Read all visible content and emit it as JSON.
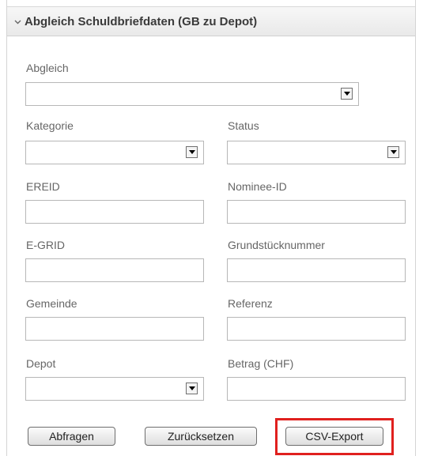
{
  "panel": {
    "title": "Abgleich Schuldbriefdaten (GB zu Depot)"
  },
  "fields": {
    "abgleich": {
      "label": "Abgleich",
      "value": ""
    },
    "kategorie": {
      "label": "Kategorie",
      "value": ""
    },
    "status": {
      "label": "Status",
      "value": ""
    },
    "ereid": {
      "label": "EREID",
      "value": ""
    },
    "nominee_id": {
      "label": "Nominee-ID",
      "value": ""
    },
    "egrid": {
      "label": "E-GRID",
      "value": ""
    },
    "grundstuecknummer": {
      "label": "Grundstücknummer",
      "value": ""
    },
    "gemeinde": {
      "label": "Gemeinde",
      "value": ""
    },
    "referenz": {
      "label": "Referenz",
      "value": ""
    },
    "depot": {
      "label": "Depot",
      "value": ""
    },
    "betrag": {
      "label": "Betrag (CHF)",
      "value": ""
    }
  },
  "buttons": {
    "query": "Abfragen",
    "reset": "Zurücksetzen",
    "csv_export": "CSV-Export"
  },
  "colors": {
    "highlight": "#e0201e",
    "header_bg": "#efefef"
  }
}
